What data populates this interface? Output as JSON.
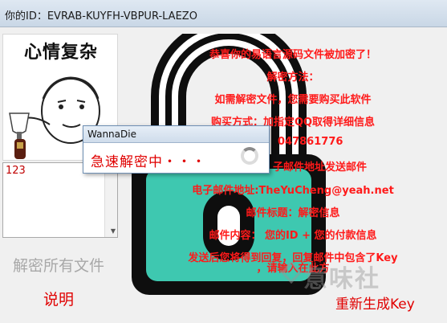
{
  "window": {
    "title": "你的ID：EVRAB-KUYFH-VBPUR-LAEZO"
  },
  "meme": {
    "caption": "心情复杂"
  },
  "input_box": {
    "value": "123"
  },
  "buttons": {
    "decrypt_all": "解密所有文件",
    "explain": "说明",
    "regenerate_key": "重新生成Key"
  },
  "ransom_note": {
    "lines": [
      "恭喜你的易语言源码文件被加密了！",
      "解密方法：",
      "如需解密文件，您需要购买此软件",
      "购买方式：加指定QQ取得详细信息",
      "047861776",
      "子邮件地址发送邮件",
      "电子邮件地址:TheYuCheng@yeah.net",
      "邮件标题：解密信息",
      "邮件内容： 您的ID + 您的付款信息",
      "发送后您将得到回复，回复邮件中包含了Key",
      "，请输入在此方"
    ]
  },
  "dialog": {
    "title": "WannaDie",
    "message": "急速解密中・・・"
  },
  "watermark": {
    "text": "意味社"
  },
  "colors": {
    "alert_red": "#ff1a1a",
    "lock_teal": "#3ec8b0",
    "lock_black": "#0e0e0e"
  }
}
